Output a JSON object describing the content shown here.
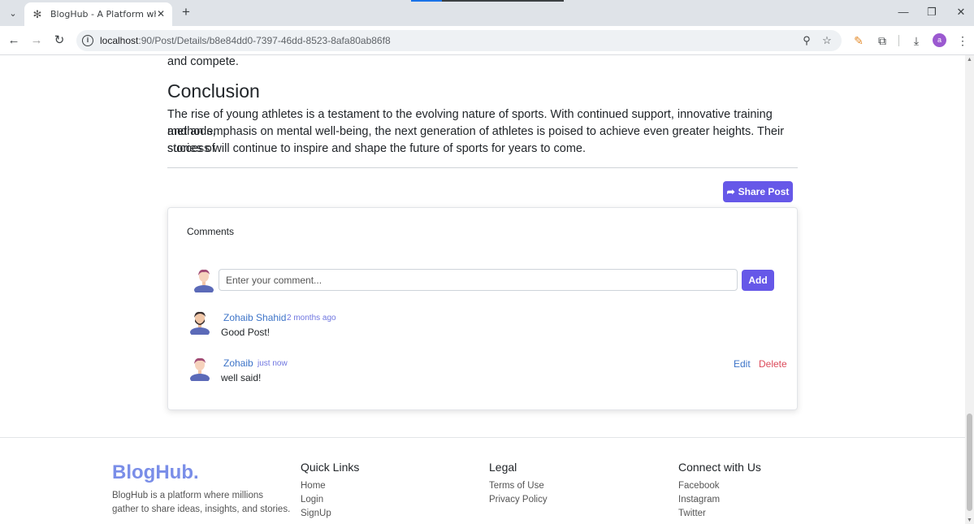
{
  "browser": {
    "tab_title": "BlogHub - A Platform where yo",
    "url_host": "localhost",
    "url_path": ":90/Post/Details/b8e84dd0-7397-46dd-8523-8afa80ab86f8",
    "profile_initial": "a"
  },
  "article": {
    "prev_paragraph_tail": "and compete.",
    "heading": "Conclusion",
    "paragraph_lines": [
      "The rise of young athletes is a testament to the evolving nature of sports. With continued support, innovative training methods,",
      "and an emphasis on mental well-being, the next generation of athletes is poised to achieve even greater heights. Their stories of",
      "success will continue to inspire and shape the future of sports for years to come."
    ]
  },
  "share": {
    "label": "Share Post"
  },
  "comments": {
    "title": "Comments",
    "input_placeholder": "Enter your comment...",
    "add_label": "Add",
    "items": [
      {
        "author": "Zohaib Shahid",
        "time": "2 months ago",
        "text": "Good Post!"
      },
      {
        "author": "Zohaib",
        "time": "just now",
        "text": "well said!",
        "edit_label": "Edit",
        "delete_label": "Delete"
      }
    ]
  },
  "footer": {
    "brand": "BlogHub.",
    "description": "BlogHub is a platform where millions gather to share ideas, insights, and stories.",
    "quick_links": {
      "title": "Quick Links",
      "links": [
        "Home",
        "Login",
        "SignUp"
      ]
    },
    "legal": {
      "title": "Legal",
      "links": [
        "Terms of Use",
        "Privacy Policy"
      ]
    },
    "connect": {
      "title": "Connect with Us",
      "links": [
        "Facebook",
        "Instagram",
        "Twitter"
      ]
    }
  },
  "colors": {
    "primary_button": "#6658e8",
    "link_blue": "#3d74c8",
    "delete_red": "#dc4a5a",
    "brand": "#7a8ee8"
  }
}
